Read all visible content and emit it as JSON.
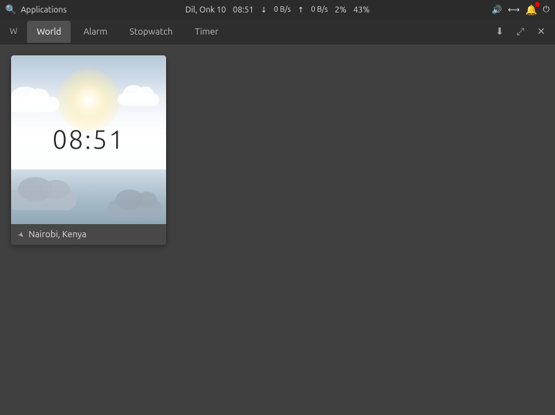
{
  "system_bar": {
    "apps_label": "Applications",
    "user_date": "Dil, Onk 10",
    "time": "08:51",
    "download_speed": "0 B/s",
    "upload_speed": "0 B/s",
    "cpu": "2%",
    "battery": "43%",
    "volume_icon": "🔊",
    "network_icon": "⟷",
    "bell_icon": "🔔",
    "power_icon": "⏻",
    "arrow_down": "↓",
    "arrow_up": "↑"
  },
  "window": {
    "short_title": "W",
    "tabs": [
      {
        "id": "world",
        "label": "World",
        "active": true
      },
      {
        "id": "alarm",
        "label": "Alarm",
        "active": false
      },
      {
        "id": "stopwatch",
        "label": "Stopwatch",
        "active": false
      },
      {
        "id": "timer",
        "label": "Timer",
        "active": false
      }
    ],
    "action_download": "⬇",
    "action_expand": "⤢",
    "action_close": "✕"
  },
  "clock_card": {
    "time": "08:51",
    "location": "Nairobi, Kenya"
  }
}
